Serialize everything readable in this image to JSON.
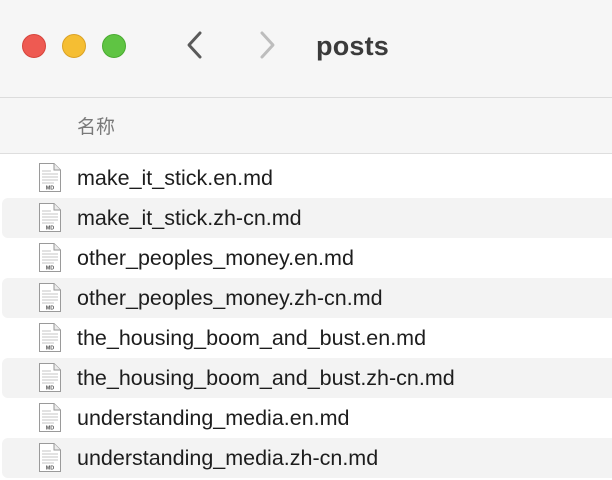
{
  "window": {
    "title": "posts"
  },
  "toolbar": {
    "back_icon": "chevron-left-icon",
    "forward_icon": "chevron-right-icon"
  },
  "columns": {
    "name": "名称"
  },
  "files": [
    {
      "name": "make_it_stick.en.md",
      "icon": "markdown-file-icon",
      "icon_label": "MD"
    },
    {
      "name": "make_it_stick.zh-cn.md",
      "icon": "markdown-file-icon",
      "icon_label": "MD"
    },
    {
      "name": "other_peoples_money.en.md",
      "icon": "markdown-file-icon",
      "icon_label": "MD"
    },
    {
      "name": "other_peoples_money.zh-cn.md",
      "icon": "markdown-file-icon",
      "icon_label": "MD"
    },
    {
      "name": "the_housing_boom_and_bust.en.md",
      "icon": "markdown-file-icon",
      "icon_label": "MD"
    },
    {
      "name": "the_housing_boom_and_bust.zh-cn.md",
      "icon": "markdown-file-icon",
      "icon_label": "MD"
    },
    {
      "name": "understanding_media.en.md",
      "icon": "markdown-file-icon",
      "icon_label": "MD"
    },
    {
      "name": "understanding_media.zh-cn.md",
      "icon": "markdown-file-icon",
      "icon_label": "MD"
    }
  ],
  "colors": {
    "close": "#ee5a52",
    "minimize": "#f5be33",
    "zoom": "#5fc443",
    "row_stripe": "#f3f3f3"
  }
}
